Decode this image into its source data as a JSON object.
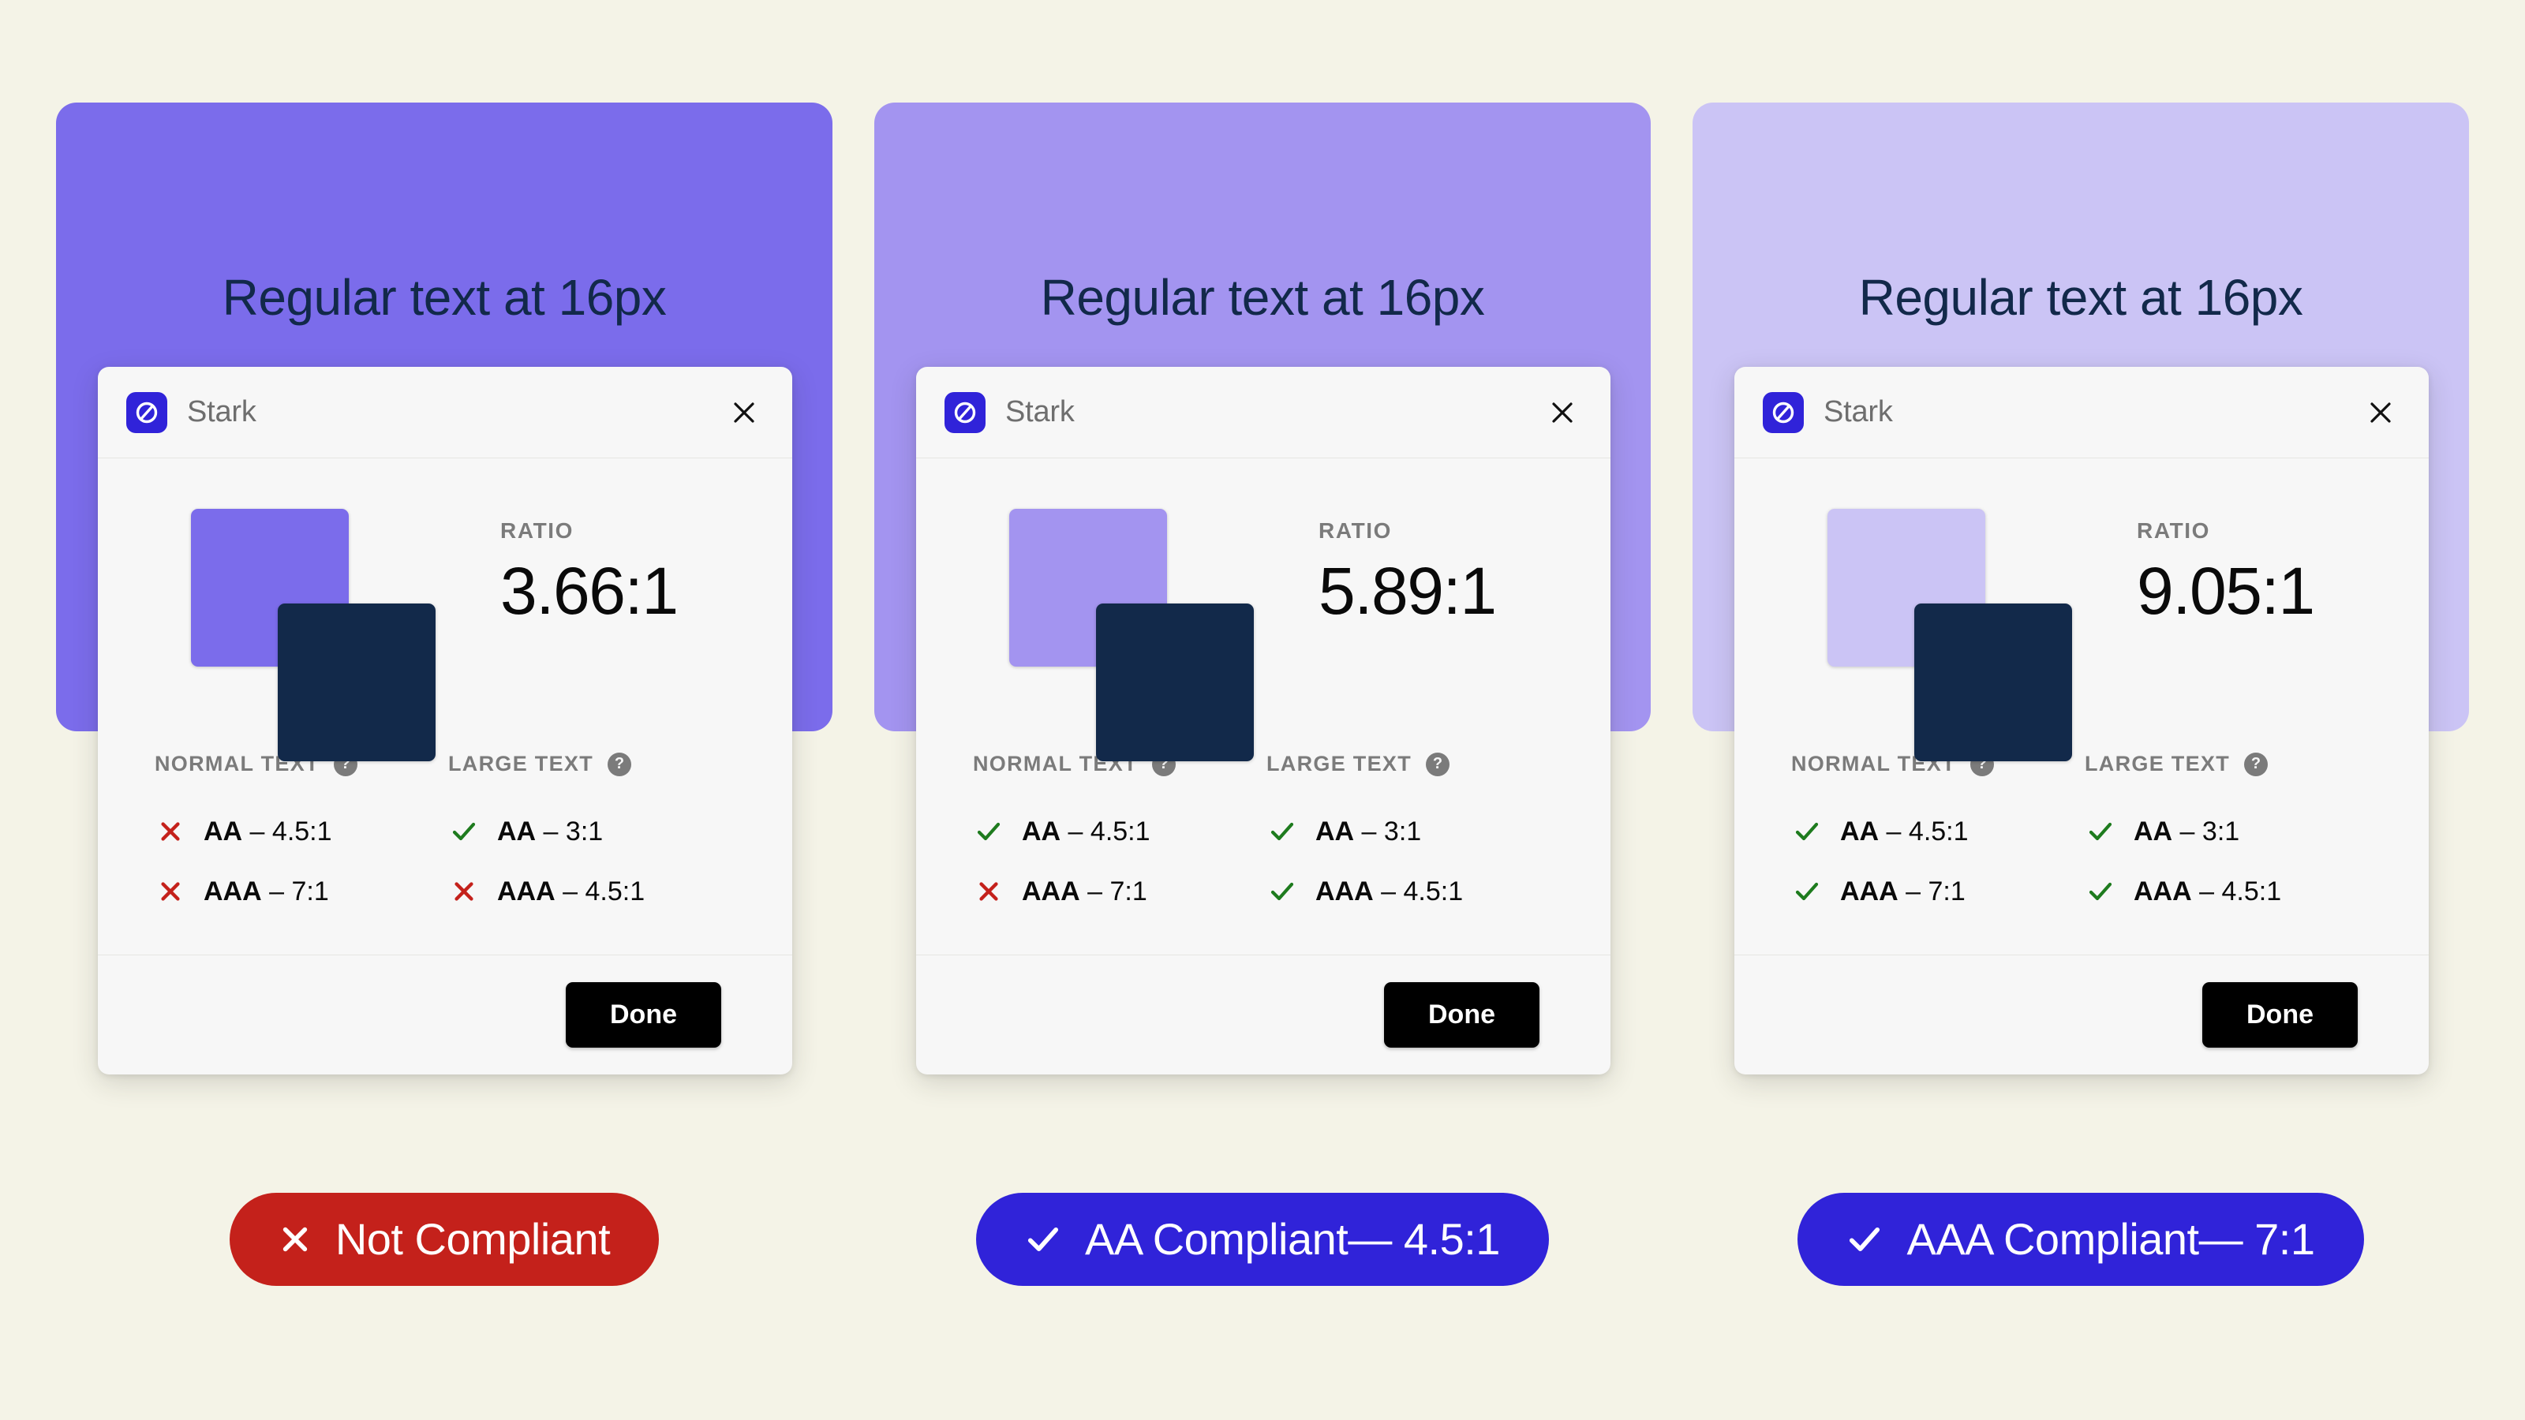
{
  "page": {
    "background_color": "#F4F3E7"
  },
  "columns": [
    {
      "panel": {
        "background_color": "#7B6CEB",
        "heading": "Regular text at 16px",
        "heading_color": "#12294A"
      },
      "card": {
        "app_name": "Stark",
        "logo_icon": "stark-logo-icon",
        "close_icon": "close-icon",
        "foreground_swatch_color": "#7B6CEB",
        "background_swatch_color": "#12294A",
        "ratio_label": "RATIO",
        "ratio_value": "3.66:1",
        "columns": [
          {
            "title": "NORMAL TEXT",
            "help_icon": "help-icon",
            "rows": [
              {
                "status": "fail",
                "level": "AA",
                "separator": " – ",
                "requirement": "4.5:1"
              },
              {
                "status": "fail",
                "level": "AAA",
                "separator": " – ",
                "requirement": "7:1"
              }
            ]
          },
          {
            "title": "LARGE TEXT",
            "help_icon": "help-icon",
            "rows": [
              {
                "status": "pass",
                "level": "AA",
                "separator": " – ",
                "requirement": "3:1"
              },
              {
                "status": "fail",
                "level": "AAA",
                "separator": " – ",
                "requirement": "4.5:1"
              }
            ]
          }
        ],
        "done_label": "Done"
      },
      "badge": {
        "icon": "cross-icon",
        "label": "Not Compliant",
        "background_color": "#C4211B",
        "text_color": "#FFFFFF"
      }
    },
    {
      "panel": {
        "background_color": "#A394F0",
        "heading": "Regular text at 16px",
        "heading_color": "#12294A"
      },
      "card": {
        "app_name": "Stark",
        "logo_icon": "stark-logo-icon",
        "close_icon": "close-icon",
        "foreground_swatch_color": "#A394F0",
        "background_swatch_color": "#12294A",
        "ratio_label": "RATIO",
        "ratio_value": "5.89:1",
        "columns": [
          {
            "title": "NORMAL TEXT",
            "help_icon": "help-icon",
            "rows": [
              {
                "status": "pass",
                "level": "AA",
                "separator": " – ",
                "requirement": "4.5:1"
              },
              {
                "status": "fail",
                "level": "AAA",
                "separator": " – ",
                "requirement": "7:1"
              }
            ]
          },
          {
            "title": "LARGE TEXT",
            "help_icon": "help-icon",
            "rows": [
              {
                "status": "pass",
                "level": "AA",
                "separator": " – ",
                "requirement": "3:1"
              },
              {
                "status": "pass",
                "level": "AAA",
                "separator": " – ",
                "requirement": "4.5:1"
              }
            ]
          }
        ],
        "done_label": "Done"
      },
      "badge": {
        "icon": "check-icon",
        "label": "AA Compliant— 4.5:1",
        "background_color": "#3023D9",
        "text_color": "#FFFFFF"
      }
    },
    {
      "panel": {
        "background_color": "#CBC4F5",
        "heading": "Regular text at 16px",
        "heading_color": "#12294A"
      },
      "card": {
        "app_name": "Stark",
        "logo_icon": "stark-logo-icon",
        "close_icon": "close-icon",
        "foreground_swatch_color": "#CBC4F5",
        "background_swatch_color": "#12294A",
        "ratio_label": "RATIO",
        "ratio_value": "9.05:1",
        "columns": [
          {
            "title": "NORMAL TEXT",
            "help_icon": "help-icon",
            "rows": [
              {
                "status": "pass",
                "level": "AA",
                "separator": " – ",
                "requirement": "4.5:1"
              },
              {
                "status": "pass",
                "level": "AAA",
                "separator": " – ",
                "requirement": "7:1"
              }
            ]
          },
          {
            "title": "LARGE TEXT",
            "help_icon": "help-icon",
            "rows": [
              {
                "status": "pass",
                "level": "AA",
                "separator": " – ",
                "requirement": "3:1"
              },
              {
                "status": "pass",
                "level": "AAA",
                "separator": " – ",
                "requirement": "4.5:1"
              }
            ]
          }
        ],
        "done_label": "Done"
      },
      "badge": {
        "icon": "check-icon",
        "label": "AAA Compliant— 7:1",
        "background_color": "#3023D9",
        "text_color": "#FFFFFF"
      }
    }
  ],
  "icons": {
    "help_glyph": "?",
    "pass_color": "#1E7B1E",
    "fail_color": "#C4211B"
  }
}
